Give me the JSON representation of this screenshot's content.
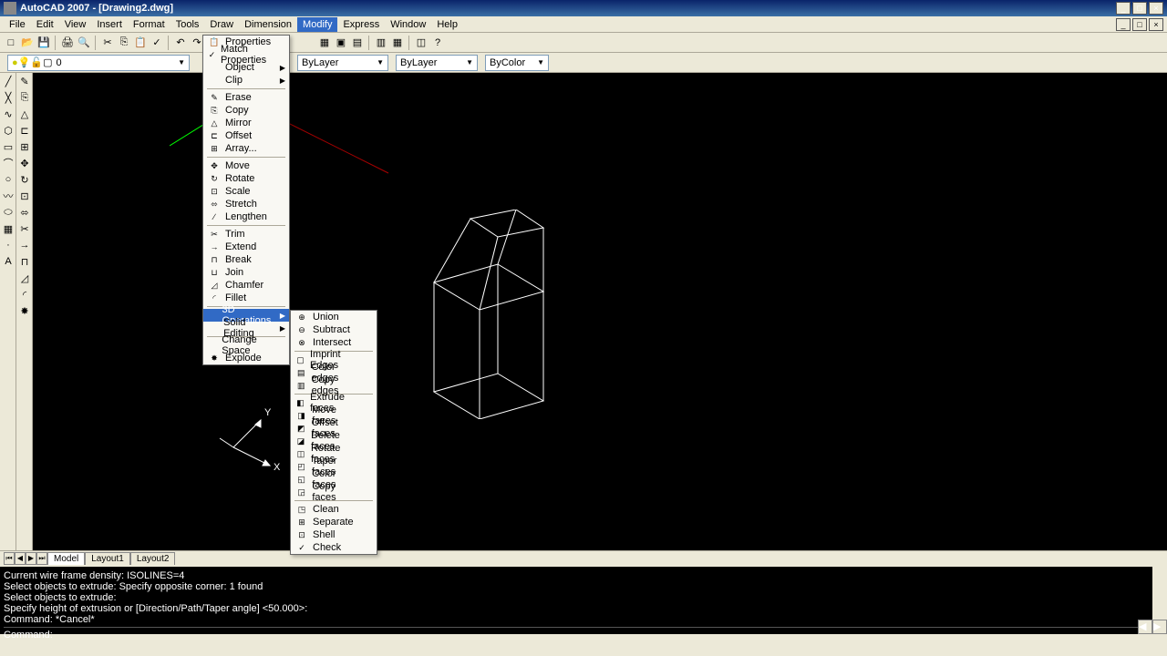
{
  "titlebar": {
    "title": "AutoCAD 2007 - [Drawing2.dwg]"
  },
  "menubar": [
    "File",
    "Edit",
    "View",
    "Insert",
    "Format",
    "Tools",
    "Draw",
    "Dimension",
    "Modify",
    "Express",
    "Window",
    "Help"
  ],
  "layer": {
    "current": "0",
    "linetype": "ByLayer",
    "lineweight": "ByLayer",
    "color": "ByColor"
  },
  "modify_menu": {
    "groups": [
      [
        {
          "label": "Properties",
          "icon": "📋",
          "arrow": false
        },
        {
          "label": "Match Properties",
          "icon": "✓",
          "arrow": false
        },
        {
          "label": "Object",
          "icon": "",
          "arrow": true
        },
        {
          "label": "Clip",
          "icon": "",
          "arrow": true
        }
      ],
      [
        {
          "label": "Erase",
          "icon": "✎",
          "arrow": false
        },
        {
          "label": "Copy",
          "icon": "⎘",
          "arrow": false
        },
        {
          "label": "Mirror",
          "icon": "△",
          "arrow": false
        },
        {
          "label": "Offset",
          "icon": "⊏",
          "arrow": false
        },
        {
          "label": "Array...",
          "icon": "⊞",
          "arrow": false
        }
      ],
      [
        {
          "label": "Move",
          "icon": "✥",
          "arrow": false
        },
        {
          "label": "Rotate",
          "icon": "↻",
          "arrow": false
        },
        {
          "label": "Scale",
          "icon": "⊡",
          "arrow": false
        },
        {
          "label": "Stretch",
          "icon": "⬄",
          "arrow": false
        },
        {
          "label": "Lengthen",
          "icon": "∕",
          "arrow": false
        }
      ],
      [
        {
          "label": "Trim",
          "icon": "✂",
          "arrow": false
        },
        {
          "label": "Extend",
          "icon": "→",
          "arrow": false
        },
        {
          "label": "Break",
          "icon": "⊓",
          "arrow": false
        },
        {
          "label": "Join",
          "icon": "⊔",
          "arrow": false
        },
        {
          "label": "Chamfer",
          "icon": "◿",
          "arrow": false
        },
        {
          "label": "Fillet",
          "icon": "◜",
          "arrow": false
        }
      ],
      [
        {
          "label": "3D Operations",
          "icon": "",
          "arrow": true,
          "highlighted": true
        },
        {
          "label": "Solid Editing",
          "icon": "",
          "arrow": true
        }
      ],
      [
        {
          "label": "Change Space",
          "icon": "",
          "arrow": false
        },
        {
          "label": "Explode",
          "icon": "✸",
          "arrow": false
        }
      ]
    ]
  },
  "submenu": {
    "groups": [
      [
        {
          "label": "Union",
          "icon": "⊕"
        },
        {
          "label": "Subtract",
          "icon": "⊖"
        },
        {
          "label": "Intersect",
          "icon": "⊗"
        }
      ],
      [
        {
          "label": "Imprint Edges",
          "icon": "▢"
        },
        {
          "label": "Color edges",
          "icon": "▤"
        },
        {
          "label": "Copy edges",
          "icon": "▥"
        }
      ],
      [
        {
          "label": "Extrude faces",
          "icon": "◧"
        },
        {
          "label": "Move faces",
          "icon": "◨"
        },
        {
          "label": "Offset faces",
          "icon": "◩"
        },
        {
          "label": "Delete faces",
          "icon": "◪"
        },
        {
          "label": "Rotate faces",
          "icon": "◫"
        },
        {
          "label": "Taper faces",
          "icon": "◰"
        },
        {
          "label": "Color faces",
          "icon": "◱"
        },
        {
          "label": "Copy faces",
          "icon": "◲"
        }
      ],
      [
        {
          "label": "Clean",
          "icon": "◳"
        },
        {
          "label": "Separate",
          "icon": "⊞"
        },
        {
          "label": "Shell",
          "icon": "⊡"
        },
        {
          "label": "Check",
          "icon": "✓"
        }
      ]
    ]
  },
  "tabs": [
    "Model",
    "Layout1",
    "Layout2"
  ],
  "active_tab": "Model",
  "command_lines": [
    "Current wire frame density:  ISOLINES=4",
    "Select objects to extrude: Specify opposite corner: 1 found",
    "Select objects to extrude:",
    "Specify height of extrusion or [Direction/Path/Taper angle] <50.000>:",
    "Command: *Cancel*"
  ],
  "command_prompt": "Command:",
  "ucs": {
    "x": "X",
    "y": "Y"
  }
}
